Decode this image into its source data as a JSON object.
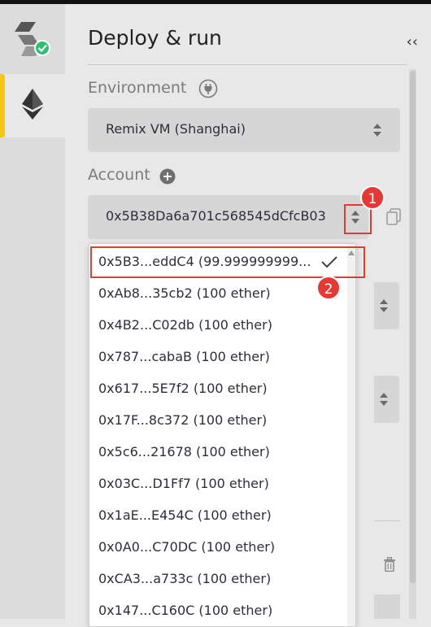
{
  "panel": {
    "title": "Deploy & run",
    "collapse_glyph": "‹‹"
  },
  "environment": {
    "label": "Environment",
    "selected": "Remix VM (Shanghai)"
  },
  "account": {
    "label": "Account",
    "selected": "0x5B38Da6a701c568545dCfcB03",
    "options": [
      "0x5B3...eddC4 (99.999999999...",
      "0xAb8...35cb2 (100 ether)",
      "0x4B2...C02db (100 ether)",
      "0x787...cabaB (100 ether)",
      "0x617...5E7f2 (100 ether)",
      "0x17F...8c372 (100 ether)",
      "0x5c6...21678 (100 ether)",
      "0x03C...D1Ff7 (100 ether)",
      "0x1aE...E454C (100 ether)",
      "0x0A0...C70DC (100 ether)",
      "0xCA3...a733c (100 ether)",
      "0x147...C160C (100 ether)"
    ]
  },
  "annotations": {
    "step1": "1",
    "step2": "2"
  },
  "colors": {
    "active_tab": "#f5c518",
    "highlight": "#e53935",
    "check_badge": "#2fbf71"
  }
}
